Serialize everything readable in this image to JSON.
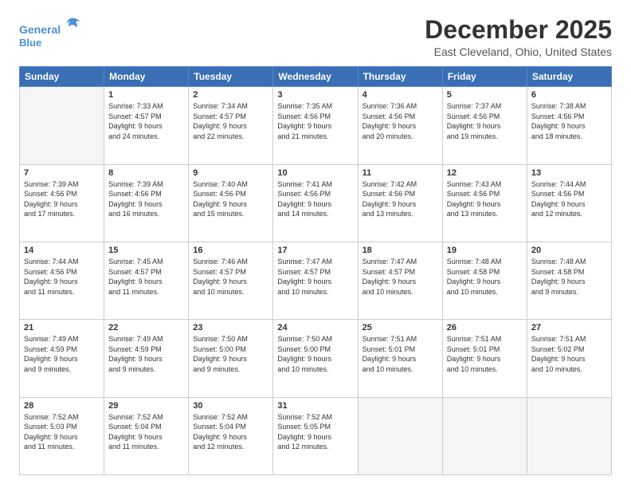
{
  "header": {
    "logo_line1": "General",
    "logo_line2": "Blue",
    "title": "December 2025",
    "subtitle": "East Cleveland, Ohio, United States"
  },
  "calendar": {
    "days_of_week": [
      "Sunday",
      "Monday",
      "Tuesday",
      "Wednesday",
      "Thursday",
      "Friday",
      "Saturday"
    ],
    "weeks": [
      [
        {
          "day": "",
          "info": ""
        },
        {
          "day": "1",
          "info": "Sunrise: 7:33 AM\nSunset: 4:57 PM\nDaylight: 9 hours\nand 24 minutes."
        },
        {
          "day": "2",
          "info": "Sunrise: 7:34 AM\nSunset: 4:57 PM\nDaylight: 9 hours\nand 22 minutes."
        },
        {
          "day": "3",
          "info": "Sunrise: 7:35 AM\nSunset: 4:56 PM\nDaylight: 9 hours\nand 21 minutes."
        },
        {
          "day": "4",
          "info": "Sunrise: 7:36 AM\nSunset: 4:56 PM\nDaylight: 9 hours\nand 20 minutes."
        },
        {
          "day": "5",
          "info": "Sunrise: 7:37 AM\nSunset: 4:56 PM\nDaylight: 9 hours\nand 19 minutes."
        },
        {
          "day": "6",
          "info": "Sunrise: 7:38 AM\nSunset: 4:56 PM\nDaylight: 9 hours\nand 18 minutes."
        }
      ],
      [
        {
          "day": "7",
          "info": "Sunrise: 7:39 AM\nSunset: 4:56 PM\nDaylight: 9 hours\nand 17 minutes."
        },
        {
          "day": "8",
          "info": "Sunrise: 7:39 AM\nSunset: 4:56 PM\nDaylight: 9 hours\nand 16 minutes."
        },
        {
          "day": "9",
          "info": "Sunrise: 7:40 AM\nSunset: 4:56 PM\nDaylight: 9 hours\nand 15 minutes."
        },
        {
          "day": "10",
          "info": "Sunrise: 7:41 AM\nSunset: 4:56 PM\nDaylight: 9 hours\nand 14 minutes."
        },
        {
          "day": "11",
          "info": "Sunrise: 7:42 AM\nSunset: 4:56 PM\nDaylight: 9 hours\nand 13 minutes."
        },
        {
          "day": "12",
          "info": "Sunrise: 7:43 AM\nSunset: 4:56 PM\nDaylight: 9 hours\nand 13 minutes."
        },
        {
          "day": "13",
          "info": "Sunrise: 7:44 AM\nSunset: 4:56 PM\nDaylight: 9 hours\nand 12 minutes."
        }
      ],
      [
        {
          "day": "14",
          "info": "Sunrise: 7:44 AM\nSunset: 4:56 PM\nDaylight: 9 hours\nand 11 minutes."
        },
        {
          "day": "15",
          "info": "Sunrise: 7:45 AM\nSunset: 4:57 PM\nDaylight: 9 hours\nand 11 minutes."
        },
        {
          "day": "16",
          "info": "Sunrise: 7:46 AM\nSunset: 4:57 PM\nDaylight: 9 hours\nand 10 minutes."
        },
        {
          "day": "17",
          "info": "Sunrise: 7:47 AM\nSunset: 4:57 PM\nDaylight: 9 hours\nand 10 minutes."
        },
        {
          "day": "18",
          "info": "Sunrise: 7:47 AM\nSunset: 4:57 PM\nDaylight: 9 hours\nand 10 minutes."
        },
        {
          "day": "19",
          "info": "Sunrise: 7:48 AM\nSunset: 4:58 PM\nDaylight: 9 hours\nand 10 minutes."
        },
        {
          "day": "20",
          "info": "Sunrise: 7:48 AM\nSunset: 4:58 PM\nDaylight: 9 hours\nand 9 minutes."
        }
      ],
      [
        {
          "day": "21",
          "info": "Sunrise: 7:49 AM\nSunset: 4:59 PM\nDaylight: 9 hours\nand 9 minutes."
        },
        {
          "day": "22",
          "info": "Sunrise: 7:49 AM\nSunset: 4:59 PM\nDaylight: 9 hours\nand 9 minutes."
        },
        {
          "day": "23",
          "info": "Sunrise: 7:50 AM\nSunset: 5:00 PM\nDaylight: 9 hours\nand 9 minutes."
        },
        {
          "day": "24",
          "info": "Sunrise: 7:50 AM\nSunset: 5:00 PM\nDaylight: 9 hours\nand 10 minutes."
        },
        {
          "day": "25",
          "info": "Sunrise: 7:51 AM\nSunset: 5:01 PM\nDaylight: 9 hours\nand 10 minutes."
        },
        {
          "day": "26",
          "info": "Sunrise: 7:51 AM\nSunset: 5:01 PM\nDaylight: 9 hours\nand 10 minutes."
        },
        {
          "day": "27",
          "info": "Sunrise: 7:51 AM\nSunset: 5:02 PM\nDaylight: 9 hours\nand 10 minutes."
        }
      ],
      [
        {
          "day": "28",
          "info": "Sunrise: 7:52 AM\nSunset: 5:03 PM\nDaylight: 9 hours\nand 11 minutes."
        },
        {
          "day": "29",
          "info": "Sunrise: 7:52 AM\nSunset: 5:04 PM\nDaylight: 9 hours\nand 11 minutes."
        },
        {
          "day": "30",
          "info": "Sunrise: 7:52 AM\nSunset: 5:04 PM\nDaylight: 9 hours\nand 12 minutes."
        },
        {
          "day": "31",
          "info": "Sunrise: 7:52 AM\nSunset: 5:05 PM\nDaylight: 9 hours\nand 12 minutes."
        },
        {
          "day": "",
          "info": ""
        },
        {
          "day": "",
          "info": ""
        },
        {
          "day": "",
          "info": ""
        }
      ]
    ]
  }
}
